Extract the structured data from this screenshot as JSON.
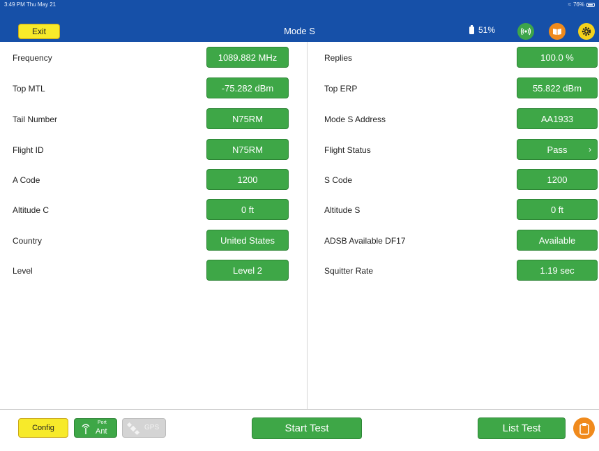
{
  "status_bar": {
    "time": "3:49 PM  Thu May 21",
    "wifi_battery": "76%"
  },
  "header": {
    "exit_label": "Exit",
    "title": "Mode S",
    "battery_percent": "51%",
    "icons": [
      "antenna-icon",
      "book-icon",
      "gear-icon"
    ]
  },
  "left_fields": [
    {
      "label": "Frequency",
      "value": "1089.882 MHz"
    },
    {
      "label": "Top MTL",
      "value": "-75.282 dBm"
    },
    {
      "label": "Tail Number",
      "value": "N75RM"
    },
    {
      "label": "Flight ID",
      "value": "N75RM"
    },
    {
      "label": "A Code",
      "value": "1200"
    },
    {
      "label": "Altitude C",
      "value": "0 ft"
    },
    {
      "label": "Country",
      "value": "United States"
    },
    {
      "label": "Level",
      "value": "Level 2"
    }
  ],
  "right_fields": [
    {
      "label": "Replies",
      "value": "100.0 %"
    },
    {
      "label": "Top ERP",
      "value": "55.822 dBm"
    },
    {
      "label": "Mode S Address",
      "value": "AA1933"
    },
    {
      "label": "Flight Status",
      "value": "Pass",
      "chevron": "›"
    },
    {
      "label": "S Code",
      "value": "1200"
    },
    {
      "label": "Altitude S",
      "value": "0 ft"
    },
    {
      "label": "ADSB Available DF17",
      "value": "Available"
    },
    {
      "label": "Squitter Rate",
      "value": "1.19 sec"
    }
  ],
  "bottom": {
    "config_label": "Config",
    "port_top": "Port",
    "port_bottom": "Ant",
    "gps_label": "GPS",
    "start_label": "Start Test",
    "list_label": "List Test"
  },
  "colors": {
    "header_blue": "#1650a8",
    "button_green": "#3ea747",
    "button_yellow": "#f7ea2a",
    "accent_orange": "#f08a1c",
    "disabled_gray": "#d4d4d4"
  }
}
